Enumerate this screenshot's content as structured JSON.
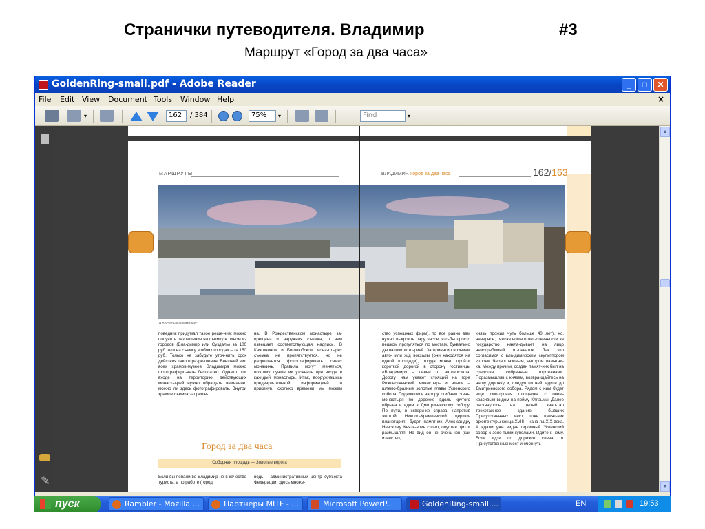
{
  "slide": {
    "title": "Странички путеводителя. Владимир",
    "number": "#3",
    "subtitle": "Маршрут «Город за два часа»"
  },
  "window": {
    "title": "GoldenRing-small.pdf - Adobe Reader",
    "controls": {
      "minimize": "_",
      "maximize": "□",
      "close": "✕"
    }
  },
  "menu": {
    "items": [
      "File",
      "Edit",
      "View",
      "Document",
      "Tools",
      "Window",
      "Help"
    ],
    "close": "×"
  },
  "toolbar": {
    "page_current": "162",
    "page_total": "/ 384",
    "zoom": "75%",
    "find_placeholder": "Find",
    "dropdown_arrow": "▾"
  },
  "document": {
    "left_header": "МАРШРУТЫ",
    "right_header_prefix": "ВЛАДИМИР.",
    "right_header_accent": "Город за два часа",
    "page_left_num": "162/",
    "page_right_num": "163",
    "photo_caption": "■ Вокзальный комплекс",
    "section_heading": "Город за два часа",
    "section_band": "Соборная площадь — Золотые ворота",
    "col1": "поведник придумал такое реше-ние: можно получить разрешение на съемку в одном из городов (Вла-димир или Суздаль) за 100 руб. или на съемку в обоих городах – за 150 руб. Только не забудьте уточ-нить срок действия такого разре-шения. Внешний вид всех храмов-музеев Владимира можно фотографиро-вать бесплатно. Однако при входе на территорию действующих монасты-рей нужно обращать внимание, можно ли здесь фотографировать. Внутри храмов съемка запреще-",
    "col2": "на. В Рождественском монастыре за-прещена и наружная съемка, о чем извещает соответствующая надпись. В Княгинином и Боголюбском мона-стырях съемка не препятствуется, но не разрешается фотографировать самих монахинь. Правила могут меняться, поэтому лучше их уточнить при входе в каж-дый монастырь. Итак, вооружившись предвари-тельной информацией и прикинув, сколько времени мы можем потра-тить на владимирские прелести, начнем осмотр.",
    "col3": "ство успешных фирм), то все равно вам нужно выкроить пару часов, что-бы просто пешком прогуляться по местам, буквально дышащим исто-рией. За ориентир возьмем авто- или ж/д вокзалы (они находятся на одной площади), откуда можно пройти короткой дорогой в сторону гостиницы «Владимир» – левее от автовокзала. Дорогу нам укажет стоящий на горе Рождественский монастырь и вдали – шлемо-бразные золотые главы Успенского собора. Поднявшись на гору, огибаем стены монастыря по дорожке вдоль крутого обрыва и идем к Дмитри-евскому собору. По пути, в сквери-ке справа, напротив желтой Николо-Кремлевской церкви-планетария, будет памятник Алек-сандру Невскому. Князь-воин сто-ит, опустив щит и размышляя. На вид он не очень юн (как известно,",
    "col4": "князь прожил чуть больше 40 лет), но, наверное, тяжкая ноша ответ-ственности за государство накла-дывает на лицо неистребимый от-печаток. Так что согласимся с вла-димирским скульптором Игорем Черноглазовым, автором памятни-ка. Между прочим, создан памят-ник был на средства, собранные горожанами. Поразмышляв с князем, возвра-щайтесь на нашу дорожку и, следуя по ней, идите до Дмитриевского собора. Рядом с ним будет еще смо-тровая площадка с очень красивым видом на пойму Клязьмы. Далее растянулось на целый квар-тал трехэтажное здание бывших Присутственных мест, тоже памят-ник архитектуры конца XVIII – нача-ла XIX века. А вдали уже виден огромный Успенский собор с золо-тыми куполами. Идите к нему. Если идти по дорожке слева от Присутственных мест и обогнуть",
    "col1_bottom": "Если вы попали во Владимир не в качестве туриста, а по работе (город",
    "col2_bottom": "ведь – административный центр субъекта Федерации, здесь множе-"
  },
  "taskbar": {
    "start": "пуск",
    "tasks": [
      "Rambler - Mozilla ...",
      "Партнеры MITF - ...",
      "Microsoft PowerP...",
      "GoldenRing-small...."
    ],
    "lang": "EN",
    "clock": "19:53"
  }
}
